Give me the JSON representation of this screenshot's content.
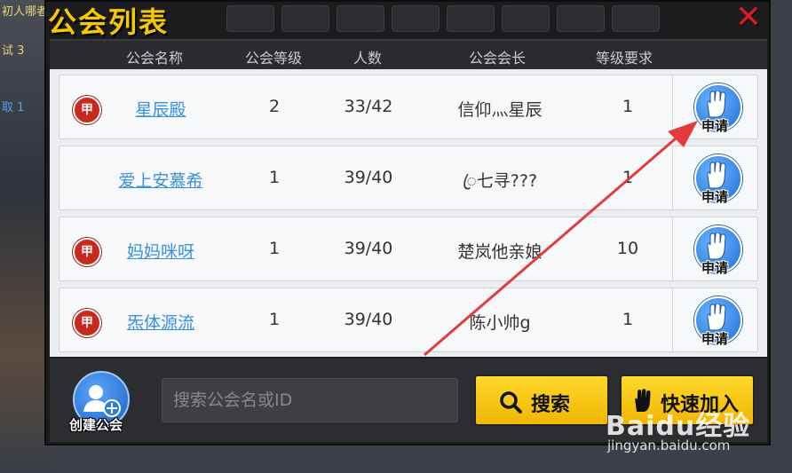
{
  "background": {
    "left_text_1": "初人哪者",
    "left_text_2": "试 3",
    "left_text_3": "取 1"
  },
  "title": "公会列表",
  "close_icon": "close-x-icon",
  "columns": [
    "公会名称",
    "公会等级",
    "人数",
    "公会会长",
    "等级要求"
  ],
  "guilds": [
    {
      "badge": "甲",
      "name": "星辰殿",
      "level": "2",
      "members": "33/42",
      "leader": "信仰灬星辰",
      "req": "1",
      "apply": "申请"
    },
    {
      "badge": "",
      "name": "爱上安慕希",
      "level": "1",
      "members": "39/40",
      "leader": "ꦿ七寻???",
      "req": "1",
      "apply": "申请"
    },
    {
      "badge": "甲",
      "name": "妈妈咪呀",
      "level": "1",
      "members": "39/40",
      "leader": "楚岚他亲娘",
      "req": "10",
      "apply": "申请"
    },
    {
      "badge": "甲",
      "name": "炁体源流",
      "level": "1",
      "members": "39/40",
      "leader": "陈小帅g",
      "req": "1",
      "apply": "申请"
    }
  ],
  "bottom": {
    "create_label": "创建公会",
    "search_placeholder": "搜索公会名或ID",
    "search_button": "搜索",
    "quick_join_button": "快速加入"
  },
  "watermark": {
    "logo": "Baidu经验",
    "url": "jingyan.baidu.com"
  },
  "colors": {
    "accent_yellow": "#f5c800",
    "link_blue": "#3a8fe0",
    "badge_red": "#c8291e",
    "arrow_red": "#e23b3b"
  }
}
